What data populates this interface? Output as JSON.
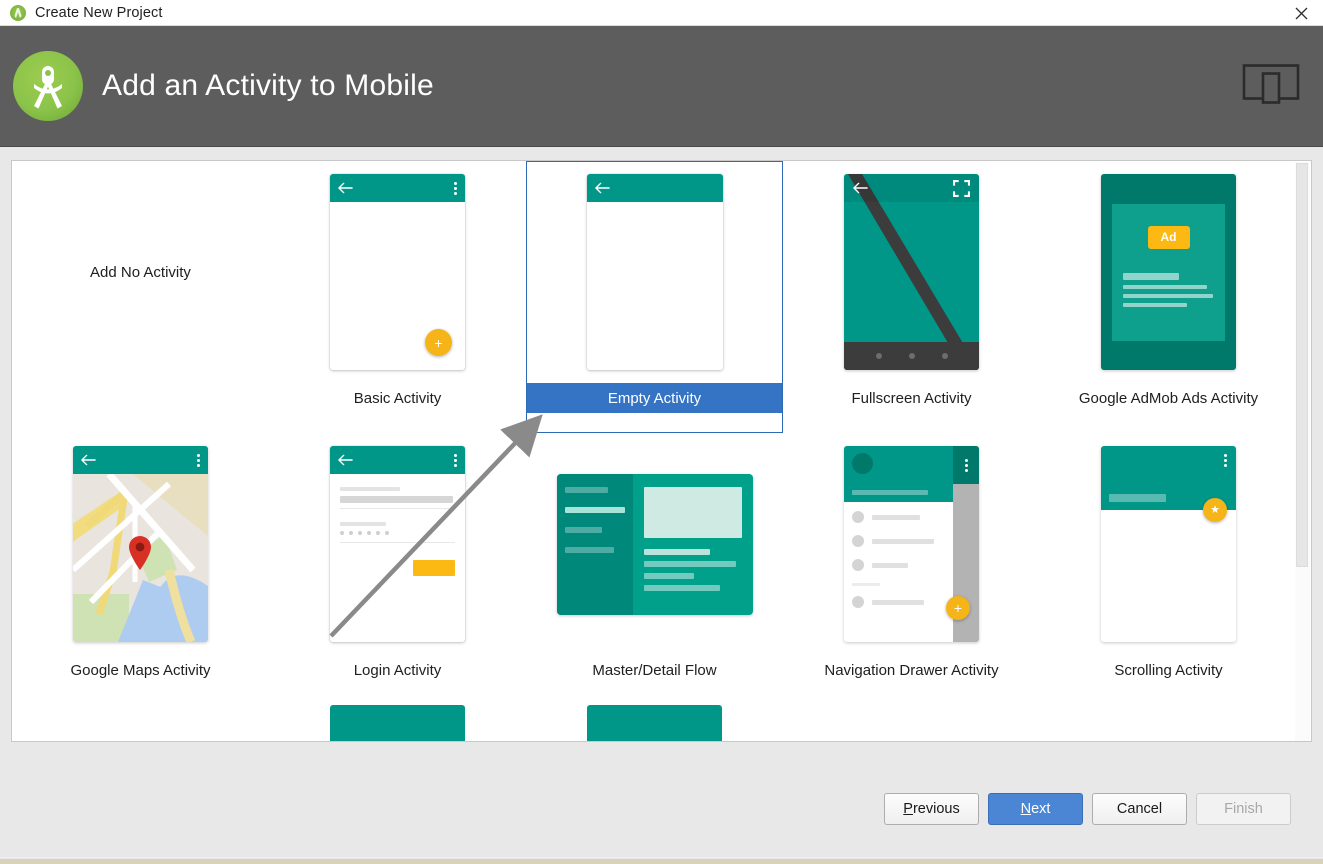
{
  "window": {
    "title": "Create New Project",
    "app_icon": "android-studio-icon",
    "close_icon": "close-icon"
  },
  "header": {
    "title": "Add an Activity to Mobile",
    "logo_icon": "android-studio-logo-icon",
    "device_icon": "device-preview-icon",
    "background": "#5d5d5d"
  },
  "colors": {
    "teal": "#009688",
    "teal_dark": "#00796b",
    "amber": "#f5b417",
    "selection_blue": "#3573c4",
    "header_gray": "#5d5d5d"
  },
  "gallery": {
    "selected": "Empty Activity",
    "items": [
      {
        "label": "Add No Activity",
        "thumb": "none"
      },
      {
        "label": "Basic Activity",
        "thumb": "basic"
      },
      {
        "label": "Empty Activity",
        "thumb": "empty"
      },
      {
        "label": "Fullscreen Activity",
        "thumb": "fullscreen"
      },
      {
        "label": "Google AdMob Ads Activity",
        "thumb": "admob"
      },
      {
        "label": "Google Maps Activity",
        "thumb": "maps"
      },
      {
        "label": "Login Activity",
        "thumb": "login"
      },
      {
        "label": "Master/Detail Flow",
        "thumb": "masterdetail"
      },
      {
        "label": "Navigation Drawer Activity",
        "thumb": "navdrawer"
      },
      {
        "label": "Scrolling Activity",
        "thumb": "scrolling"
      }
    ],
    "admob_badge": "Ad"
  },
  "footer": {
    "buttons": [
      {
        "label": "Previous",
        "mnemonic": "P",
        "state": "normal"
      },
      {
        "label": "Next",
        "mnemonic": "N",
        "state": "primary"
      },
      {
        "label": "Cancel",
        "mnemonic": "",
        "state": "normal"
      },
      {
        "label": "Finish",
        "mnemonic": "",
        "state": "disabled"
      }
    ]
  },
  "annotation": {
    "type": "arrow",
    "points_to": "Empty Activity"
  }
}
